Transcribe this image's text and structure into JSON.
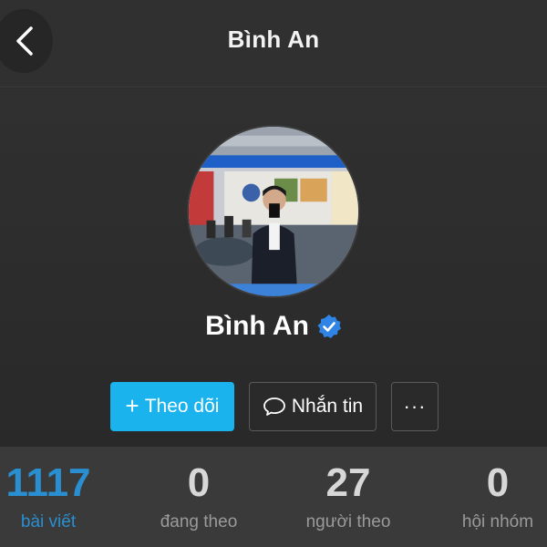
{
  "header": {
    "title": "Bình An",
    "back_icon": "chevron-left-icon"
  },
  "profile": {
    "name": "Bình An",
    "verified_icon": "verified-badge-icon",
    "verified_color": "#2f84e6",
    "avatar_description_icon": "avatar-photo"
  },
  "actions": {
    "follow_label": "Theo dõi",
    "follow_icon": "plus-icon",
    "message_label": "Nhắn tin",
    "message_icon": "chat-bubble-icon",
    "more_label": "···",
    "accent": "#1ab3ee"
  },
  "stats": [
    {
      "value": "1117",
      "label": "bài viết",
      "active": true
    },
    {
      "value": "0",
      "label": "đang theo",
      "active": false
    },
    {
      "value": "27",
      "label": "người theo",
      "active": false
    },
    {
      "value": "0",
      "label": "hội nhóm",
      "active": false
    }
  ]
}
